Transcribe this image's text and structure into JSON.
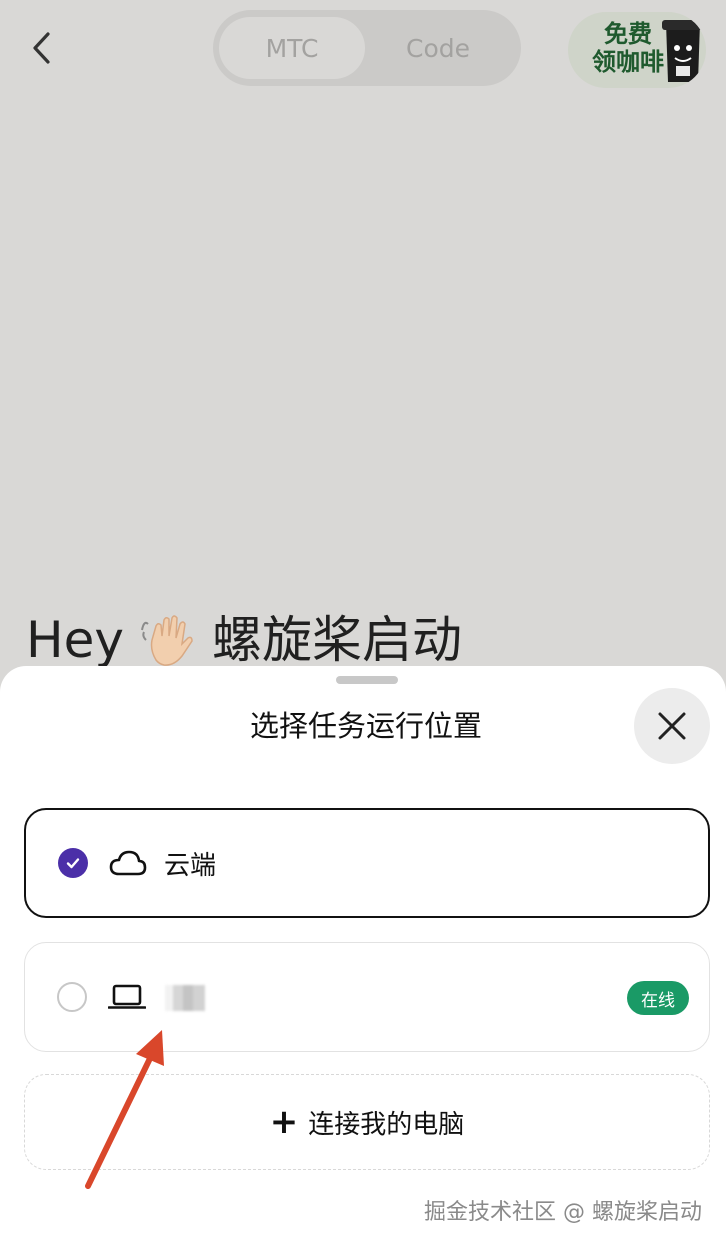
{
  "header": {
    "tabs": [
      {
        "label": "MTC",
        "active": true
      },
      {
        "label": "Code",
        "active": false
      }
    ],
    "promo": {
      "line1": "免费",
      "line2": "领咖啡"
    }
  },
  "greeting": {
    "prefix": "Hey",
    "emoji": "waving-hand",
    "name": "螺旋桨启动"
  },
  "sheet": {
    "title": "选择任务运行位置",
    "options": [
      {
        "label": "云端",
        "icon": "cloud-icon",
        "selected": true
      },
      {
        "label": "",
        "icon": "laptop-icon",
        "selected": false,
        "status": "在线"
      }
    ],
    "connect_label": "连接我的电脑"
  },
  "watermark": "掘金技术社区 @ 螺旋桨启动",
  "colors": {
    "accent_purple": "#4b2fa8",
    "online_green": "#1a9a66",
    "annotation_red": "#d9472b"
  }
}
